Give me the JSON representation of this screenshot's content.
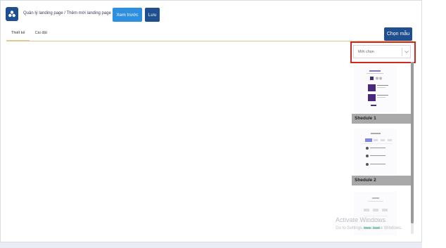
{
  "header": {
    "breadcrumb": "Quản lý landing page / Thêm mới landing page",
    "preview_label": "Xem trước",
    "save_label": "Lưu"
  },
  "tabs": [
    {
      "label": "Thiết kế",
      "active": true
    },
    {
      "label": "Cài đặt",
      "active": false
    }
  ],
  "template_button_label": "Chọn mẫu",
  "template_panel": {
    "select_placeholder": "Mới chọn",
    "templates": [
      {
        "name": ""
      },
      {
        "name": "Shedule 1"
      },
      {
        "name": "Shedule 2"
      }
    ]
  },
  "watermark": {
    "line1": "Activate Windows",
    "line2": "Go to Settings to activate Windows."
  },
  "colors": {
    "primary_dark": "#1f4f8f",
    "primary_light": "#2d8fe0",
    "highlight": "#d0281e",
    "tab_underline": "#e2c88e",
    "template_accent": "#4a2a7a"
  }
}
